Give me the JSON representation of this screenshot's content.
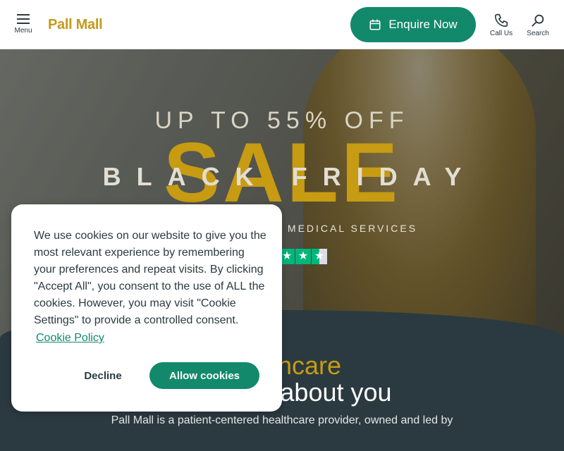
{
  "header": {
    "menu_label": "Menu",
    "logo_text": "Pall Mall",
    "enquire_label": "Enquire Now",
    "call_label": "Call Us",
    "search_label": "Search"
  },
  "hero": {
    "promo_line": "UP TO 55% OFF",
    "sale_text": "SALE",
    "black_friday_text": "BLACK FRIDAY",
    "services_text": "MEDICAL SERVICES",
    "star_rating": 4.5
  },
  "section": {
    "heading_line1": "healthcare",
    "heading_line2": "That's all about you",
    "intro_text": "Pall Mall is a patient-centered healthcare provider, owned and led by"
  },
  "cookie_banner": {
    "message": "We use cookies on our website to give you the most relevant experience by remembering your preferences and repeat visits. By clicking \"Accept All\", you consent to the use of ALL the cookies. However, you may visit \"Cookie Settings\" to provide a controlled consent.",
    "policy_link": "Cookie Policy",
    "decline_label": "Decline",
    "allow_label": "Allow cookies"
  },
  "colors": {
    "brand_gold": "#c49a1a",
    "brand_green": "#12896a",
    "dark_navy": "#2b3a40"
  },
  "icons": [
    "hamburger-icon",
    "calendar-icon",
    "phone-icon",
    "search-icon",
    "star-icon"
  ]
}
